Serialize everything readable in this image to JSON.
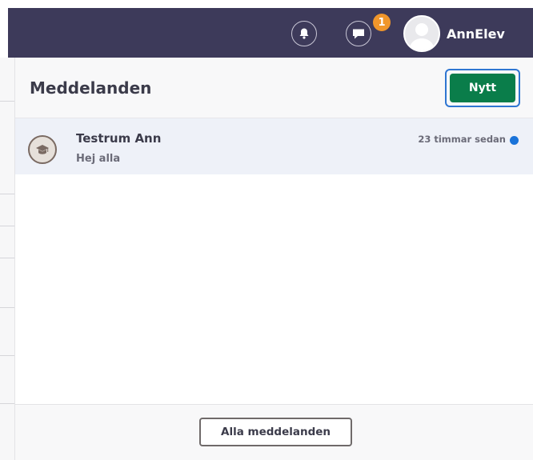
{
  "header": {
    "notifications_icon": "bell-icon",
    "messages_icon": "chat-bubble-icon",
    "messages_badge": "1",
    "username": "AnnElev",
    "colors": {
      "bar": "#3d3a5a",
      "badge": "#f0962b"
    }
  },
  "panel": {
    "title": "Meddelanden",
    "new_button_label": "Nytt",
    "messages": [
      {
        "sender": "Testrum Ann",
        "preview": "Hej alla",
        "time": "23 timmar sedan",
        "unread": true,
        "avatar_icon": "graduation-cap-icon"
      }
    ],
    "all_messages_label": "Alla meddelanden",
    "colors": {
      "new_button": "#0a7d4a",
      "unread_dot": "#1a73d9",
      "row_highlight": "#eef1f8"
    }
  }
}
